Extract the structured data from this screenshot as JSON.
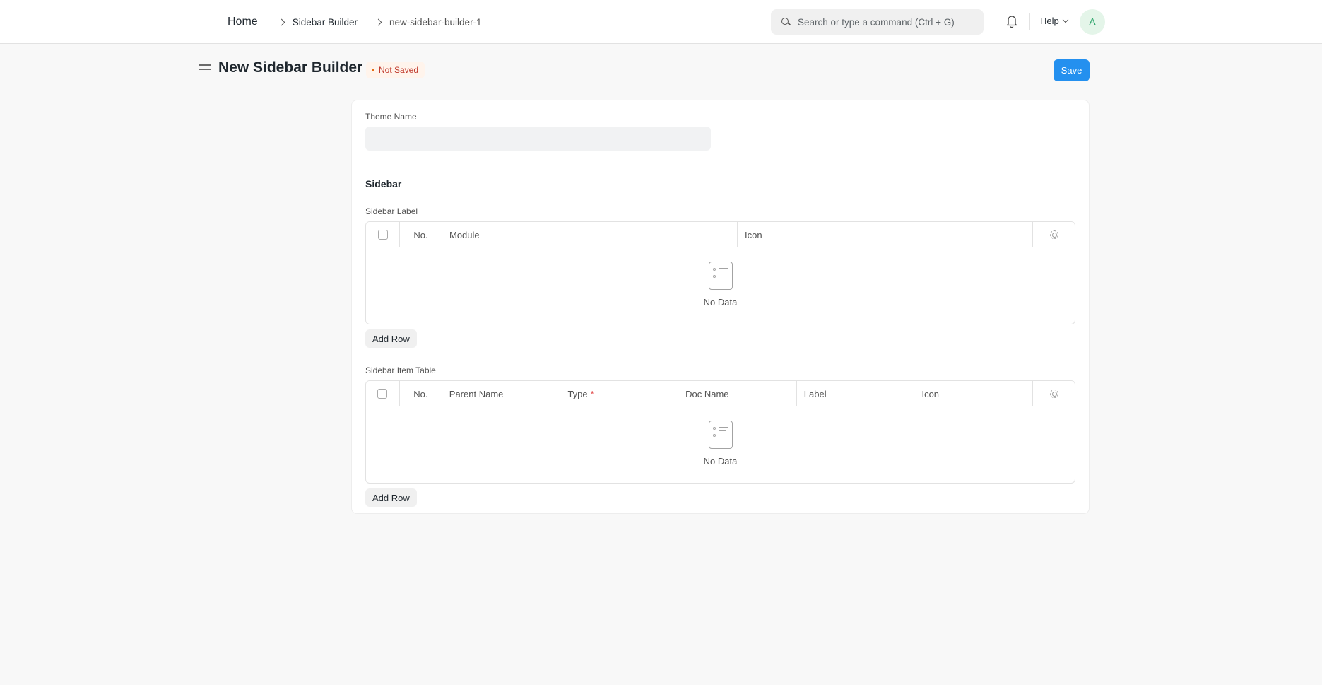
{
  "navbar": {
    "breadcrumbs": [
      "Home",
      "Sidebar Builder",
      "new-sidebar-builder-1"
    ],
    "search_placeholder": "Search or type a command (Ctrl + G)",
    "help_label": "Help",
    "avatar_initial": "A"
  },
  "page": {
    "title": "New Sidebar Builder",
    "status_badge": "Not Saved",
    "save_label": "Save"
  },
  "form": {
    "theme_name_label": "Theme Name",
    "theme_name_value": "",
    "section_title": "Sidebar",
    "sidebar_label_table": {
      "label": "Sidebar Label",
      "columns": [
        "No.",
        "Module",
        "Icon"
      ],
      "rows": [],
      "empty_text": "No Data",
      "add_row_label": "Add Row"
    },
    "sidebar_item_table": {
      "label": "Sidebar Item Table",
      "columns": [
        "No.",
        "Parent Name",
        "Type",
        "Doc Name",
        "Label",
        "Icon"
      ],
      "required_marker": "*",
      "rows": [],
      "empty_text": "No Data",
      "add_row_label": "Add Row"
    }
  },
  "colors": {
    "primary": "#2490ef",
    "badge_bg": "#fff4ec",
    "badge_text": "#c0392b",
    "avatar_bg": "#e4f5e9",
    "avatar_text": "#30a66d"
  }
}
